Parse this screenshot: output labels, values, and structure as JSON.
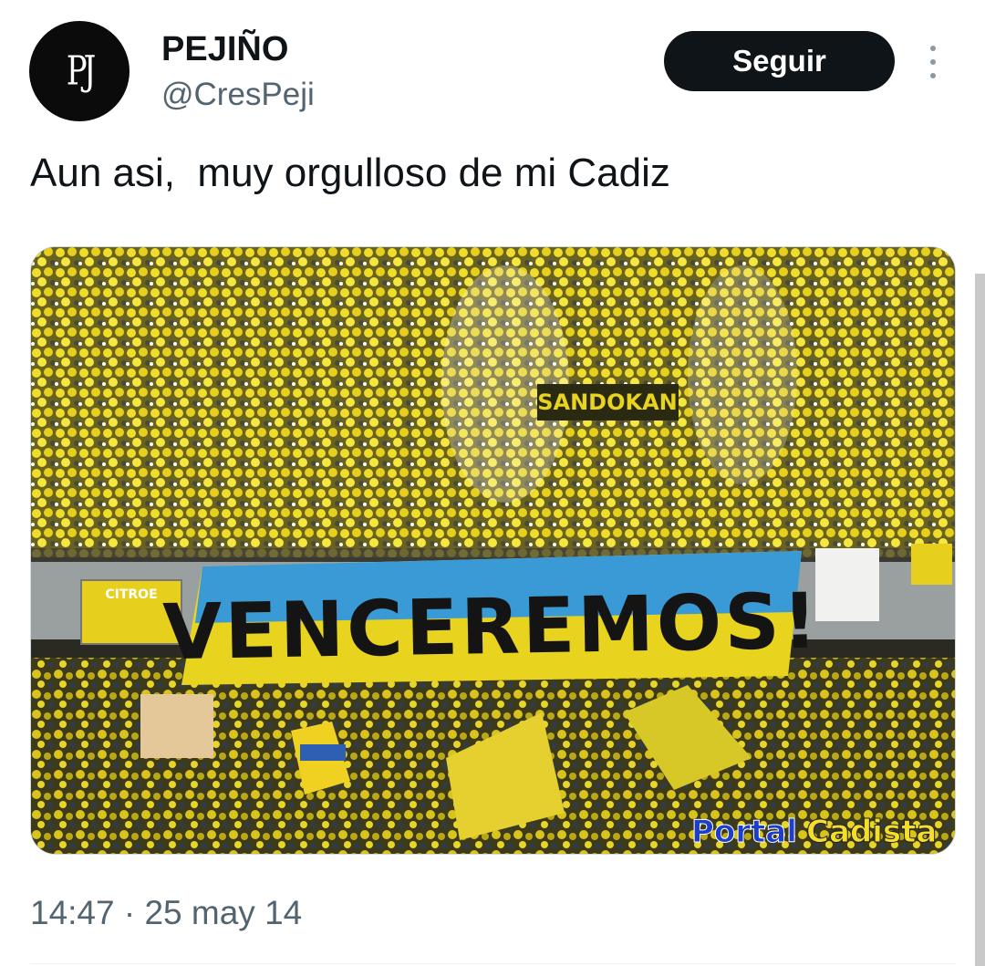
{
  "author": {
    "display_name": "PEJIÑO",
    "handle": "@CresPeji",
    "avatar_monogram": "PJ"
  },
  "actions": {
    "follow_label": "Seguir",
    "more_icon": "more-vertical-icon"
  },
  "tweet": {
    "text": "Aun asi,  muy orgulloso de mi Cadiz",
    "timestamp": "14:47 · 25 may 14"
  },
  "media": {
    "banner_text": "VENCEREMOS!",
    "top_banner_text": "SANDOKAN",
    "sign_text": "CITROE",
    "watermark_part1": "Portal",
    "watermark_part2": "Cadista"
  },
  "colors": {
    "follow_bg": "#0f1419",
    "secondary_text": "#536471",
    "fan_yellow": "#e8d31f",
    "banner_blue": "#3a9ad6"
  }
}
